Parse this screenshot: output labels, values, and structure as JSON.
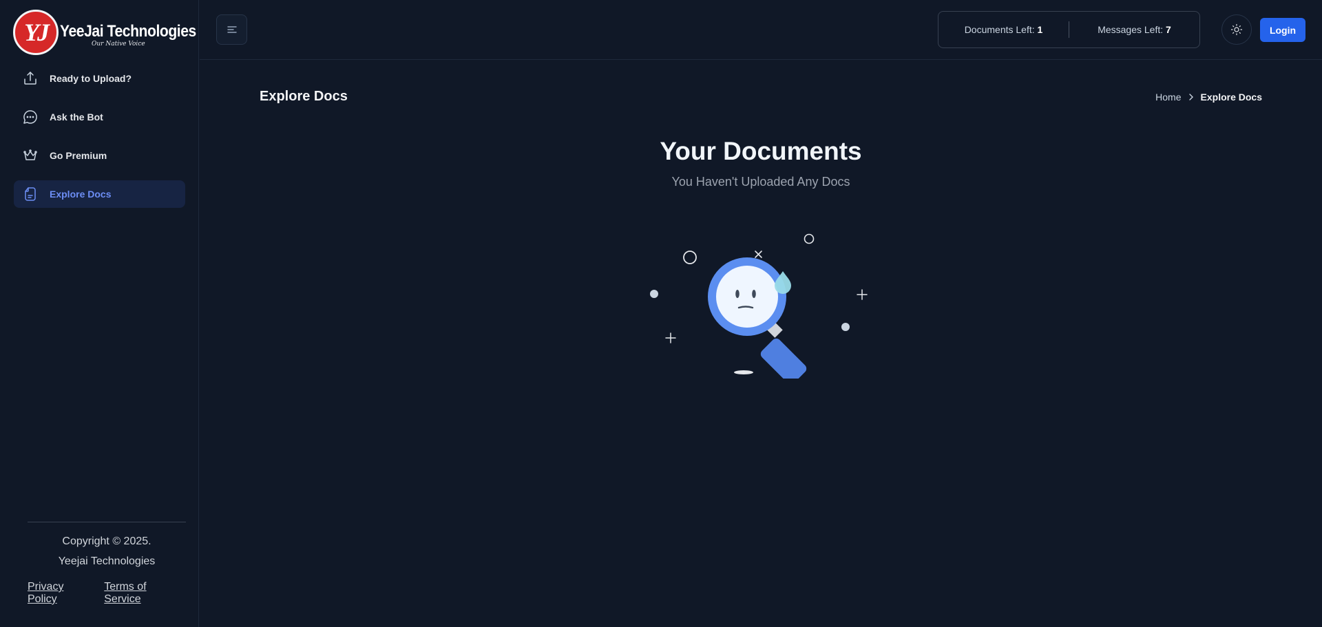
{
  "brand": {
    "mark": "YJ",
    "name": "YeeJai Technologies",
    "tagline": "Our Native Voice"
  },
  "sidebar": {
    "items": [
      {
        "label": "Ready to Upload?",
        "icon": "upload-icon"
      },
      {
        "label": "Ask the Bot",
        "icon": "chat-icon"
      },
      {
        "label": "Go Premium",
        "icon": "crown-icon"
      },
      {
        "label": "Explore Docs",
        "icon": "document-icon",
        "active": true
      }
    ],
    "footer": {
      "copyright_line1": "Copyright © 2025.",
      "copyright_line2": "Yeejai Technologies",
      "privacy": "Privacy Policy",
      "terms": "Terms of Service"
    }
  },
  "header": {
    "documents_label": "Documents Left:",
    "documents_value": "1",
    "messages_label": "Messages Left:",
    "messages_value": "7",
    "login": "Login"
  },
  "page": {
    "title": "Explore Docs",
    "breadcrumb_home": "Home",
    "breadcrumb_current": "Explore Docs",
    "heading": "Your Documents",
    "subheading": "You Haven't Uploaded Any Docs"
  },
  "colors": {
    "background": "#101827",
    "accent": "#2563eb",
    "active_nav_bg": "#172443",
    "active_nav_text": "#6d8ef5"
  }
}
